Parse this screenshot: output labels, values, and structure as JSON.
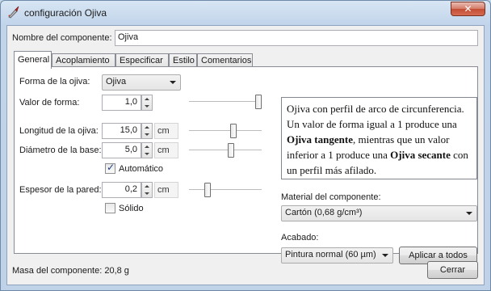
{
  "window": {
    "title": "configuración Ojiva",
    "close_glyph": "✕"
  },
  "component_name": {
    "label": "Nombre del componente:",
    "value": "Ojiva"
  },
  "tabs": [
    {
      "label": "General"
    },
    {
      "label": "Acoplamiento"
    },
    {
      "label": "Especificar"
    },
    {
      "label": "Estilo"
    },
    {
      "label": "Comentarios"
    }
  ],
  "general": {
    "shape_label": "Forma de la ojiva:",
    "shape_value": "Ojiva",
    "shape_param_label": "Valor de forma:",
    "shape_param_value": "1,0",
    "shape_param_slider_fraction": 1.0,
    "length_label": "Longitud de la ojiva:",
    "length_value": "15,0",
    "length_unit": "cm",
    "length_slider_fraction": 0.62,
    "diameter_label": "Diámetro de la base:",
    "diameter_value": "5,0",
    "diameter_unit": "cm",
    "diameter_slider_fraction": 0.58,
    "automatic_label": "Automático",
    "automatic_checked": true,
    "thickness_label": "Espesor de la pared:",
    "thickness_value": "0,2",
    "thickness_unit": "cm",
    "thickness_slider_fraction": 0.23,
    "solid_label": "Sólido",
    "solid_checked": false,
    "description": {
      "p1": "Ojiva con perfil de arco de circunferencia. Un valor de forma igual a 1 produce una ",
      "b1": "Ojiva tangente",
      "p2": ", mientras que un valor inferior a 1 produce una ",
      "b2": "Ojiva secante",
      "p3": " con un perfil más afilado."
    },
    "material_label": "Material del componente:",
    "material_value": "Cartón (0,68 g/cm³)",
    "finish_label": "Acabado:",
    "finish_value": "Pintura normal (60 µm)",
    "apply_all_button": "Aplicar a todos"
  },
  "footer": {
    "mass_text": "Masa del componente: 20,8 g",
    "close_button": "Cerrar"
  }
}
